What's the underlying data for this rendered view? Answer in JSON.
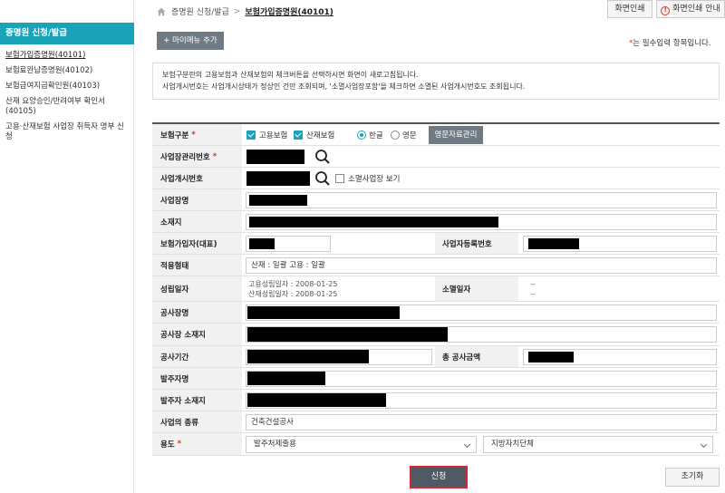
{
  "sidebar": {
    "title": "증명원 신청/발급",
    "items": [
      {
        "label": "보험가입증명원(40101)"
      },
      {
        "label": "보험료완납증명원(40102)"
      },
      {
        "label": "보험급여지급확인원(40103)"
      },
      {
        "label": "산재 요양승인/반려여부 확인서 (40105)"
      },
      {
        "label": "고용·산재보험 사업장 취득자 명부 신청"
      }
    ]
  },
  "breadcrumb": {
    "parent": "증명원 신청/발급",
    "current": "보험가입증명원(40101)"
  },
  "top_buttons": {
    "print": "화면인쇄",
    "guide": "화면인쇄 안내"
  },
  "mymenu_label": "+ 마이메뉴 추가",
  "required_note": {
    "star": "*",
    "text": "는 필수입력 항목입니다."
  },
  "notice": {
    "line1": "보험구분란의 고용보험과 산재보험의 체크버튼을 선택하시면 화면이 새로고침됩니다.",
    "line2": "사업개시번호는 사업개시상태가 정상인 건만 조회되며, '소멸사업장포함'을 체크하면 소멸된 사업개시번호도 조회됩니다."
  },
  "form": {
    "insurance_type": {
      "label": "보험구분",
      "employment": "고용보험",
      "industrial": "산재보험",
      "korean": "한글",
      "english": "영문",
      "mgmt_button": "영문자료관리"
    },
    "site_mgmt_no": {
      "label": "사업장관리번호"
    },
    "business_start_no": {
      "label": "사업개시번호",
      "closed_check": "소멸사업장 보기"
    },
    "site_name": {
      "label": "사업장명"
    },
    "address": {
      "label": "소재지"
    },
    "insured_rep": {
      "label": "보험가입자(대표)"
    },
    "biz_reg_no": {
      "label": "사업자등록번호"
    },
    "apply_type": {
      "label": "적용형태",
      "value": "산재 : 일괄 고용 : 일괄"
    },
    "est_date": {
      "label": "성립일자",
      "emp": "고용성립일자 : 2008-01-25",
      "ind": "산재성립일자 : 2008-01-25"
    },
    "close_date": {
      "label": "소멸일자",
      "v1": "--",
      "v2": "--"
    },
    "construction_name": {
      "label": "공사장명"
    },
    "construction_address": {
      "label": "공사장 소재지"
    },
    "construction_period": {
      "label": "공사기간"
    },
    "total_amount": {
      "label": "총 공사금액"
    },
    "client_name": {
      "label": "발주자명"
    },
    "client_address": {
      "label": "발주자 소재지"
    },
    "business_type": {
      "label": "사업의 종류",
      "value": "건축건설공사"
    },
    "usage": {
      "label": "용도",
      "select1": "발주처제출용",
      "select2": "지방자치단체"
    }
  },
  "actions": {
    "apply": "신청",
    "reset": "초기화"
  }
}
